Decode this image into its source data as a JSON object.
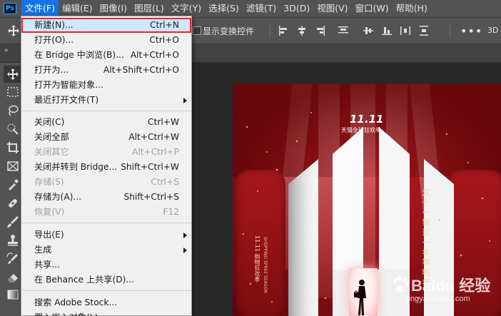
{
  "menubar": {
    "logo": "Ps",
    "items": [
      {
        "label": "文件(F)",
        "active": true
      },
      {
        "label": "编辑(E)"
      },
      {
        "label": "图像(I)"
      },
      {
        "label": "图层(L)"
      },
      {
        "label": "文字(Y)"
      },
      {
        "label": "选择(S)"
      },
      {
        "label": "滤镜(T)"
      },
      {
        "label": "3D(D)"
      },
      {
        "label": "视图(V)"
      },
      {
        "label": "窗口(W)"
      },
      {
        "label": "帮助(H)"
      }
    ]
  },
  "options": {
    "show_transform_label": "显示变换控件",
    "more_label": "•••",
    "threed_label": "3D"
  },
  "tabstrip": {
    "collapse_glyph": "»"
  },
  "file_menu": {
    "groups": [
      [
        {
          "label": "新建(N)...",
          "shortcut": "Ctrl+N",
          "highlighted": true
        },
        {
          "label": "打开(O)...",
          "shortcut": "Ctrl+O"
        },
        {
          "label": "在 Bridge 中浏览(B)...",
          "shortcut": "Alt+Ctrl+O"
        },
        {
          "label": "打开为...",
          "shortcut": "Alt+Shift+Ctrl+O"
        },
        {
          "label": "打开为智能对象..."
        },
        {
          "label": "最近打开文件(T)",
          "submenu": true
        }
      ],
      [
        {
          "label": "关闭(C)",
          "shortcut": "Ctrl+W"
        },
        {
          "label": "关闭全部",
          "shortcut": "Alt+Ctrl+W"
        },
        {
          "label": "关闭其它",
          "shortcut": "Alt+Ctrl+P",
          "disabled": true
        },
        {
          "label": "关闭并转到 Bridge...",
          "shortcut": "Shift+Ctrl+W"
        },
        {
          "label": "存储(S)",
          "shortcut": "Ctrl+S",
          "disabled": true
        },
        {
          "label": "存储为(A)...",
          "shortcut": "Shift+Ctrl+S"
        },
        {
          "label": "恢复(V)",
          "shortcut": "F12",
          "disabled": true
        }
      ],
      [
        {
          "label": "导出(E)",
          "submenu": true
        },
        {
          "label": "生成",
          "submenu": true
        },
        {
          "label": "共享..."
        },
        {
          "label": "在 Behance 上共享(D)..."
        }
      ],
      [
        {
          "label": "搜索 Adobe Stock..."
        },
        {
          "label": "置入嵌入对象(L)..."
        }
      ]
    ]
  },
  "poster": {
    "logo_numbers": "11.11",
    "logo_sub": "天猫全球狂欢季",
    "main_vertical": "双十一错过一年等明年",
    "left_vertical_1": "11.11 购物狂欢季",
    "left_vertical_2": "SHOPPING SPREE SEASON"
  },
  "watermark": {
    "text": "Baidu 经验",
    "url": "jingyan.baidu.com"
  },
  "colors": {
    "accent": "#1473e6",
    "highlight_border": "#e4262f",
    "highlight_fill": "#cde8ff"
  }
}
